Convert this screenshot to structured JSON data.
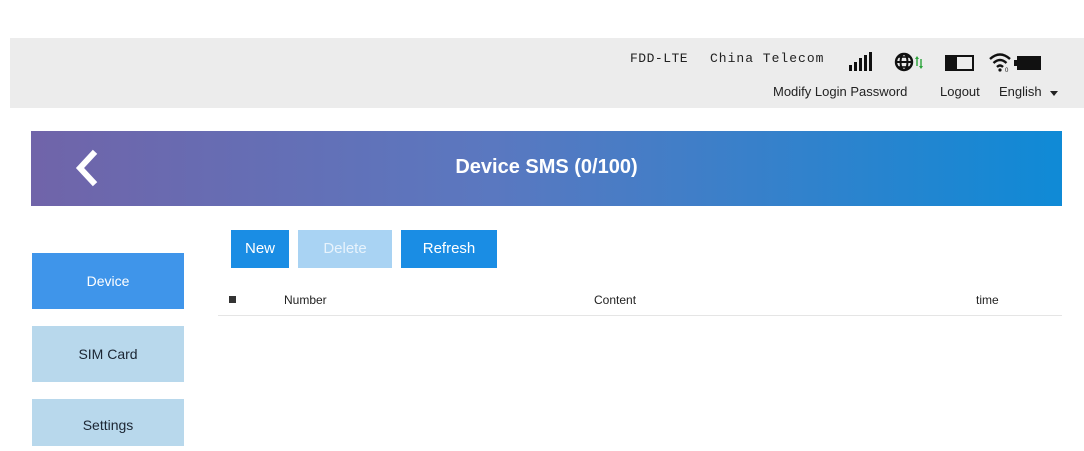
{
  "status": {
    "network_type": "FDD-LTE",
    "carrier": "China Telecom",
    "links": {
      "modify_password": "Modify Login Password",
      "logout": "Logout",
      "language": "English"
    },
    "icons": [
      "signal-icon",
      "globe-data-icon",
      "sim-icon",
      "wifi-icon",
      "battery-icon"
    ]
  },
  "page": {
    "title": "Device SMS (0/100)",
    "back_icon": "chevron-left-icon"
  },
  "toolbar": {
    "new_label": "New",
    "delete_label": "Delete",
    "refresh_label": "Refresh"
  },
  "sidebar": {
    "items": [
      {
        "label": "Device",
        "active": true
      },
      {
        "label": "SIM Card",
        "active": false
      },
      {
        "label": "Settings",
        "active": false
      }
    ]
  },
  "table": {
    "columns": [
      "Number",
      "Content",
      "time"
    ],
    "rows": []
  },
  "colors": {
    "header_gradient_start": "#7064a9",
    "header_gradient_end": "#0f8ad6",
    "primary_button": "#1a8de4",
    "disabled_button": "#a9d3f3",
    "sidebar_active": "#3f95ea",
    "sidebar_inactive": "#b8d8ec",
    "topbar": "#ececec"
  }
}
